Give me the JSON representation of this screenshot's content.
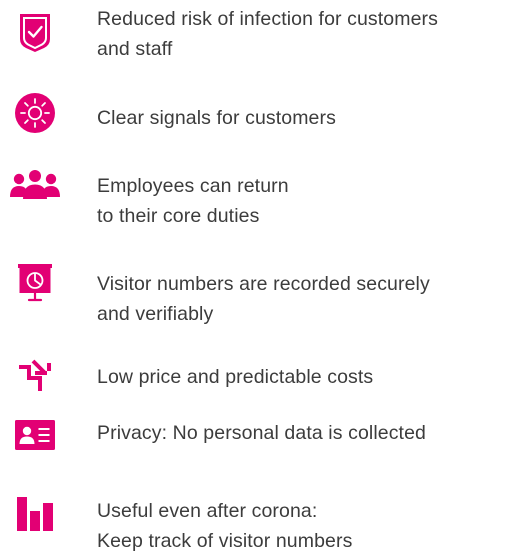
{
  "accent_color": "#e20074",
  "features": [
    {
      "icon": "shield-check-icon",
      "lines": [
        "Reduced risk of infection for customers",
        "and staff"
      ]
    },
    {
      "icon": "sun-signal-icon",
      "lines": [
        "Clear signals for customers"
      ]
    },
    {
      "icon": "people-group-icon",
      "lines": [
        "Employees can return",
        "to their core duties"
      ]
    },
    {
      "icon": "presentation-chart-icon",
      "lines": [
        "Visitor numbers are recorded securely",
        "and verifiably"
      ]
    },
    {
      "icon": "price-decrease-arrow-icon",
      "lines": [
        "Low price and predictable costs"
      ]
    },
    {
      "icon": "id-card-icon",
      "lines": [
        "Privacy: No personal data is collected"
      ]
    },
    {
      "icon": "bar-chart-icon",
      "lines": [
        "Useful even after corona:",
        "Keep track of visitor numbers"
      ]
    }
  ]
}
